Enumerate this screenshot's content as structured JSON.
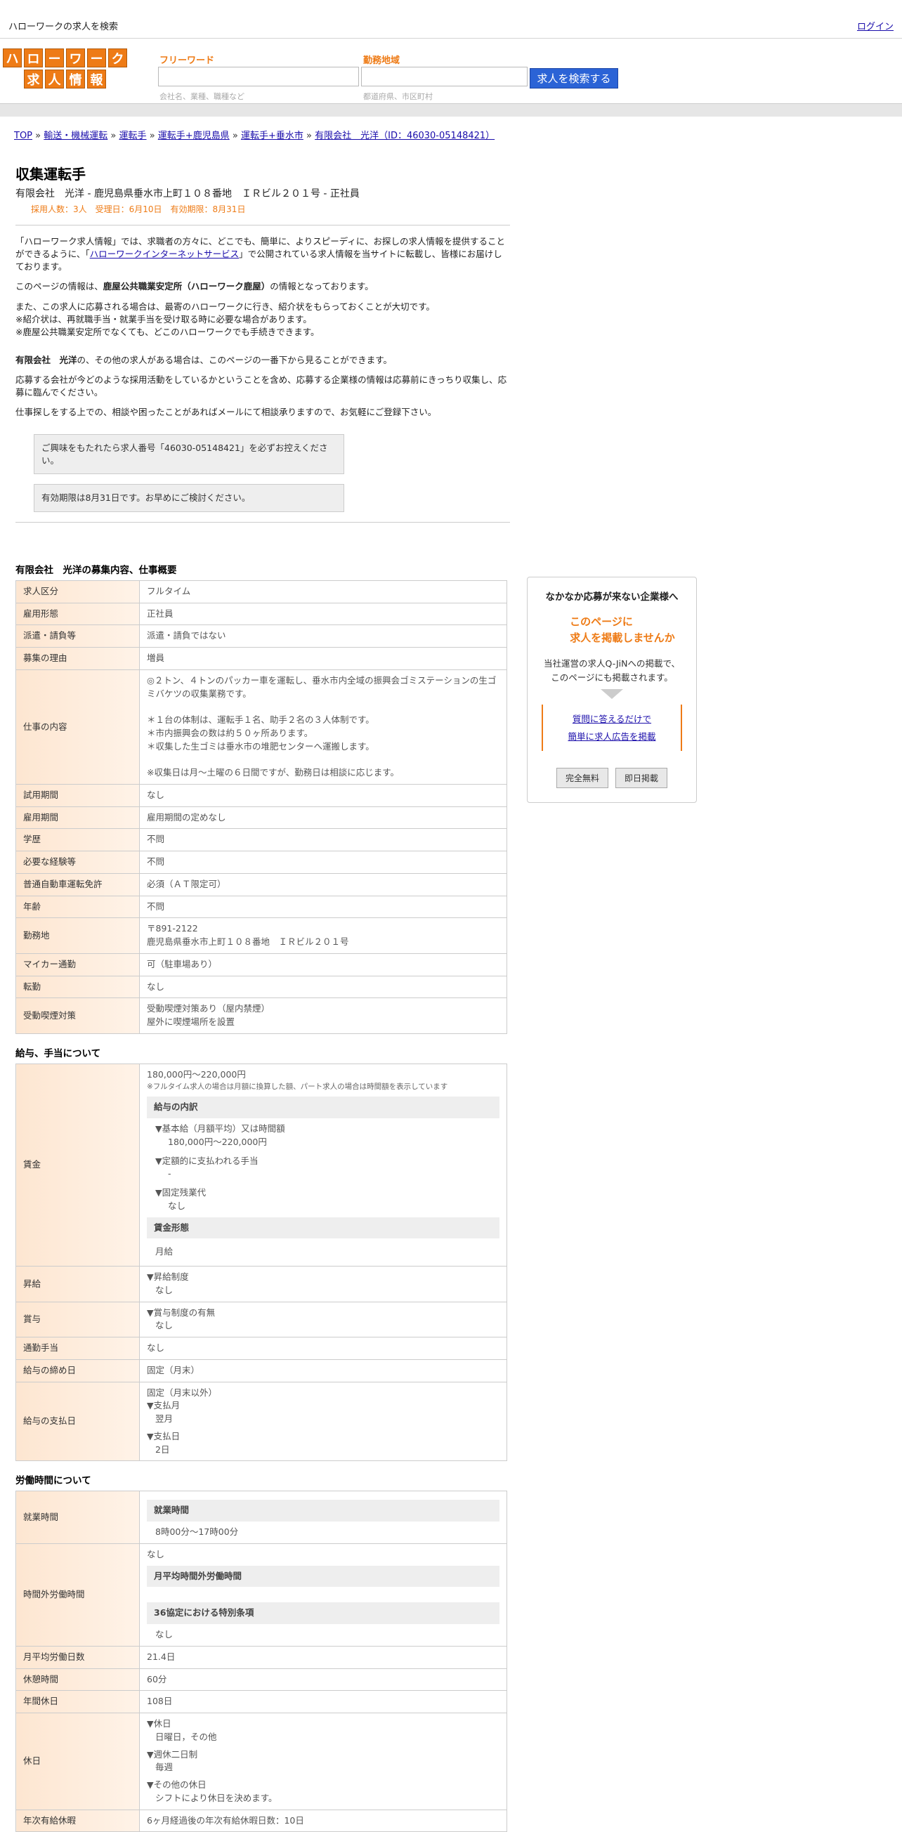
{
  "topbar": {
    "site_title": "ハローワークの求人を検索",
    "login": "ログイン"
  },
  "logo": {
    "row1": [
      "ハ",
      "ロ",
      "ー",
      "ワ",
      "ー",
      "ク"
    ],
    "row2": [
      "求",
      "人",
      "情",
      "報"
    ]
  },
  "search": {
    "freeword_label": "フリーワード",
    "freeword_placeholder": "会社名、業種、職種など",
    "area_label": "勤務地域",
    "area_placeholder": "都道府県、市区町村",
    "button": "求人を検索する"
  },
  "breadcrumb": {
    "top": "TOP",
    "sep": "»",
    "c1": "輸送・機械運転",
    "c2": "運転手",
    "c3": "運転手+鹿児島県",
    "c4": "運転手+垂水市",
    "c5": "有限会社　光洋（ID：46030-05148421）"
  },
  "job": {
    "title": "収集運転手",
    "subtitle": "有限会社　光洋 - 鹿児島県垂水市上町１０８番地　ＩＲビル２０１号 - 正社員",
    "meta": "採用人数：3人　受理日：6月10日　有効期限：8月31日"
  },
  "intro": {
    "p1a": "「ハローワーク求人情報」では、求職者の方々に、どこでも、簡単に、よりスピーディに、お探しの求人情報を提供することができるように、「",
    "p1link": "ハローワークインターネットサービス",
    "p1b": "」で公開されている求人情報を当サイトに転載し、皆様にお届けしております。",
    "p2a": "このページの情報は、",
    "p2b": "鹿屋公共職業安定所（ハローワーク鹿屋）",
    "p2c": "の情報となっております。",
    "p3": "また、この求人に応募される場合は、最寄のハローワークに行き、紹介状をもらっておくことが大切です。",
    "p3b": "※紹介状は、再就職手当・就業手当を受け取る時に必要な場合があります。",
    "p3c": "※鹿屋公共職業安定所でなくても、どこのハローワークでも手続きできます。",
    "p4a": "有限会社　光洋",
    "p4b": "の、その他の求人がある場合は、このページの一番下から見ることができます。",
    "p5": "応募する会社が今どのような採用活動をしているかということを含め、応募する企業様の情報は応募前にきっちり収集し、応募に臨んでください。",
    "p6": "仕事探しをする上での、相談や困ったことがあればメールにて相談承りますので、お気軽にご登録下さい。",
    "note1": "ご興味をもたれたら求人番号「46030-05148421」を必ずお控えください。",
    "note2": "有効期限は8月31日です。お早めにご検討ください。"
  },
  "overview": {
    "heading": "有限会社　光洋の募集内容、仕事概要",
    "rows": [
      {
        "k": "求人区分",
        "v": "フルタイム"
      },
      {
        "k": "雇用形態",
        "v": "正社員"
      },
      {
        "k": "派遣・請負等",
        "v": "派遣・請負ではない"
      },
      {
        "k": "募集の理由",
        "v": "増員"
      },
      {
        "k": "仕事の内容",
        "v": "◎２トン、４トンのパッカー車を運転し、垂水市内全域の振興会ゴミステーションの生ゴミバケツの収集業務です。\n\n＊１台の体制は、運転手１名、助手２名の３人体制です。\n＊市内振興会の数は約５０ヶ所あります。\n＊収集した生ゴミは垂水市の堆肥センターへ運搬します。\n\n※収集日は月～土曜の６日間ですが、勤務日は相談に応じます。"
      },
      {
        "k": "試用期間",
        "v": "なし"
      },
      {
        "k": "雇用期間",
        "v": "雇用期間の定めなし"
      },
      {
        "k": "学歴",
        "v": "不問"
      },
      {
        "k": "必要な経験等",
        "v": "不問"
      },
      {
        "k": "普通自動車運転免許",
        "v": "必須（ＡＴ限定可）"
      },
      {
        "k": "年齢",
        "v": "不問"
      },
      {
        "k": "勤務地",
        "v": "〒891-2122\n鹿児島県垂水市上町１０８番地　ＩＲビル２０１号"
      },
      {
        "k": "マイカー通勤",
        "v": "可（駐車場あり）"
      },
      {
        "k": "転勤",
        "v": "なし"
      },
      {
        "k": "受動喫煙対策",
        "v": "受動喫煙対策あり（屋内禁煙）\n屋外に喫煙場所を設置"
      }
    ]
  },
  "salary": {
    "heading": "給与、手当について",
    "wage_label": "賃金",
    "wage_range": "180,000円〜220,000円",
    "wage_note": "※フルタイム求人の場合は月額に換算した額、パート求人の場合は時間額を表示しています",
    "breakdown_title": "給与の内訳",
    "b1_label": "▼基本給（月額平均）又は時間額",
    "b1_value": "180,000円〜220,000円",
    "b2_label": "▼定額的に支払われる手当",
    "b2_value": "-",
    "b3_label": "▼固定残業代",
    "b3_value": "なし",
    "form_title": "賃金形態",
    "form_value": "月給",
    "raise_label": "昇給",
    "raise_v1": "▼昇給制度",
    "raise_v2": "なし",
    "bonus_label": "賞与",
    "bonus_v1": "▼賞与制度の有無",
    "bonus_v2": "なし",
    "commute_label": "通勤手当",
    "commute_v": "なし",
    "close_label": "給与の締め日",
    "close_v": "固定（月末）",
    "pay_label": "給与の支払日",
    "pay_v1": "固定（月末以外）",
    "pay_v2": "▼支払月",
    "pay_v3": "翌月",
    "pay_v4": "▼支払日",
    "pay_v5": "2日"
  },
  "work": {
    "heading": "労働時間について",
    "hours_label": "就業時間",
    "hours_sub": "就業時間",
    "hours_v": "8時00分〜17時00分",
    "ot_label": "時間外労働時間",
    "ot_v": "なし",
    "ot_sub1": "月平均時間外労働時間",
    "ot_sub2": "36協定における特別条項",
    "ot_v2": "なし",
    "days_label": "月平均労働日数",
    "days_v": "21.4日",
    "rest_label": "休憩時間",
    "rest_v": "60分",
    "annual_label": "年間休日",
    "annual_v": "108日",
    "holiday_label": "休日",
    "h1": "▼休日",
    "h2": "日曜日，その他",
    "h3": "▼週休二日制",
    "h4": "毎週",
    "h5": "▼その他の休日",
    "h6": "シフトにより休日を決めます。",
    "paid_label": "年次有給休暇",
    "paid_v": "6ヶ月経過後の年次有給休暇日数：10日"
  },
  "sidebar": {
    "title": "なかなか応募が来ない企業様へ",
    "catch1": "このページに",
    "catch2": "求人を掲載しませんか",
    "desc1": "当社運営の求人Q-JiNへの掲載で、",
    "desc2": "このページにも掲載されます。",
    "link1": "質問に答えるだけで",
    "link2": "簡単に求人広告を掲載",
    "btn1": "完全無料",
    "btn2": "即日掲載"
  }
}
